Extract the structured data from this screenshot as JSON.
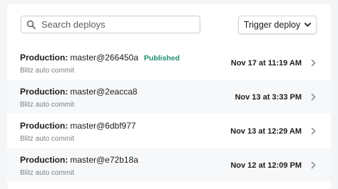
{
  "search": {
    "placeholder": "Search deploys",
    "icon": "search-icon"
  },
  "toolbar": {
    "trigger_label": "Trigger deploy",
    "trigger_icon": "chevron-down-icon"
  },
  "deploys": [
    {
      "context": "Production:",
      "ref": "master@266450a",
      "badge": "Published",
      "message": "Blitz auto commit",
      "date": "Nov 17 at 11:19 AM"
    },
    {
      "context": "Production:",
      "ref": "master@2eacca8",
      "badge": "",
      "message": "Blitz auto commit",
      "date": "Nov 13 at 3:33 PM"
    },
    {
      "context": "Production:",
      "ref": "master@6dbf977",
      "badge": "",
      "message": "Blitz auto commit",
      "date": "Nov 13 at 12:29 AM"
    },
    {
      "context": "Production:",
      "ref": "master@e72b18a",
      "badge": "",
      "message": "Blitz auto commit",
      "date": "Nov 12 at 12:09 PM"
    }
  ],
  "colors": {
    "published": "#1d8a6e",
    "row_alt": "#f7f8f9",
    "muted": "#7a7f86"
  }
}
